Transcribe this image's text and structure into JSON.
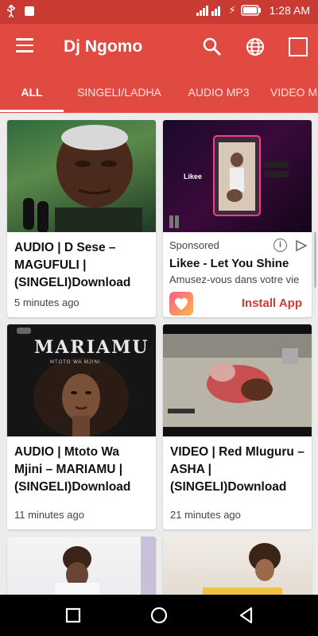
{
  "status_bar": {
    "time": "1:28 AM"
  },
  "app_bar": {
    "title": "Dj Ngomo",
    "icons": [
      "menu-icon",
      "search-icon",
      "globe-icon",
      "square-icon"
    ]
  },
  "tabs": [
    {
      "label": "ALL",
      "active": true
    },
    {
      "label": "SINGELI/LADHA",
      "active": false
    },
    {
      "label": "AUDIO MP3",
      "active": false
    },
    {
      "label": "VIDEO M",
      "active": false
    }
  ],
  "posts": [
    {
      "title": "AUDIO | D Sese – MAGUFULI | (SINGELI)Download",
      "time": "5 minutes ago"
    },
    {
      "title": "AUDIO | Mtoto Wa Mjini – MARIAMU | (SINGELI)Download",
      "time": "11 minutes ago"
    },
    {
      "title": "VIDEO | Red Mluguru – ASHA | (SINGELI)Download",
      "time": "21 minutes ago"
    }
  ],
  "ad": {
    "label": "Sponsored",
    "title": "Likee - Let You Shine",
    "description": "Amusez-vous dans votre vie",
    "cta": "Install App",
    "image_brand": "Likee"
  },
  "thumbnails": {
    "mariamu_text": "MARIAMU",
    "mariamu_sub": "MTOTO WA MJINI"
  },
  "colors": {
    "primary": "#e04a40",
    "status_bar": "#c83a32",
    "cta": "#d13a2f"
  }
}
